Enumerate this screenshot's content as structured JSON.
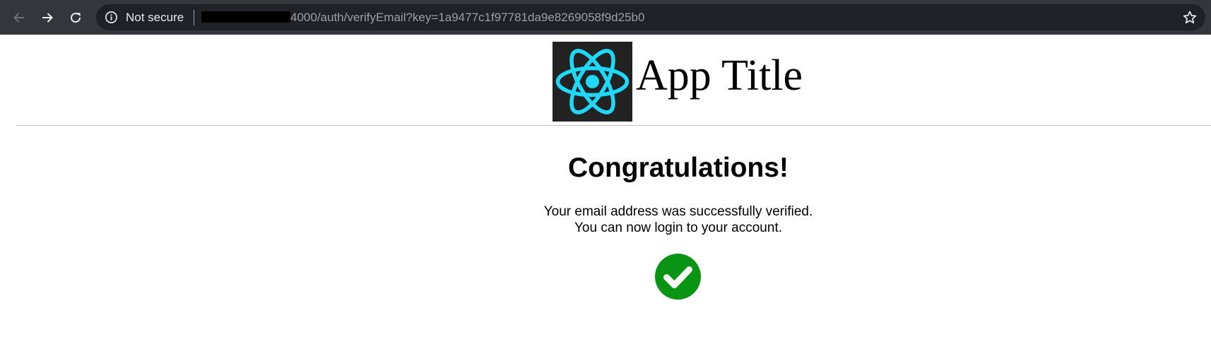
{
  "browser": {
    "security_label": "Not secure",
    "url_text": "4000/auth/verifyEmail?key=1a9477c1f97781da9e8269058f9d25b0"
  },
  "header": {
    "app_title": "App Title"
  },
  "main": {
    "heading": "Congratulations!",
    "message_line1": "Your email address was successfully verified.",
    "message_line2": "You can now login to your account."
  },
  "colors": {
    "browser_bar": "#35363a",
    "omnibox": "#202124",
    "react_logo": "#1ed8f8",
    "logo_bg": "#222222",
    "success_green": "#0a9413"
  },
  "icons": {
    "back": "arrow-left-icon",
    "forward": "arrow-right-icon",
    "reload": "reload-icon",
    "info": "info-icon",
    "bookmark": "star-icon",
    "logo": "react-atom-icon",
    "status": "check-circle-icon"
  }
}
